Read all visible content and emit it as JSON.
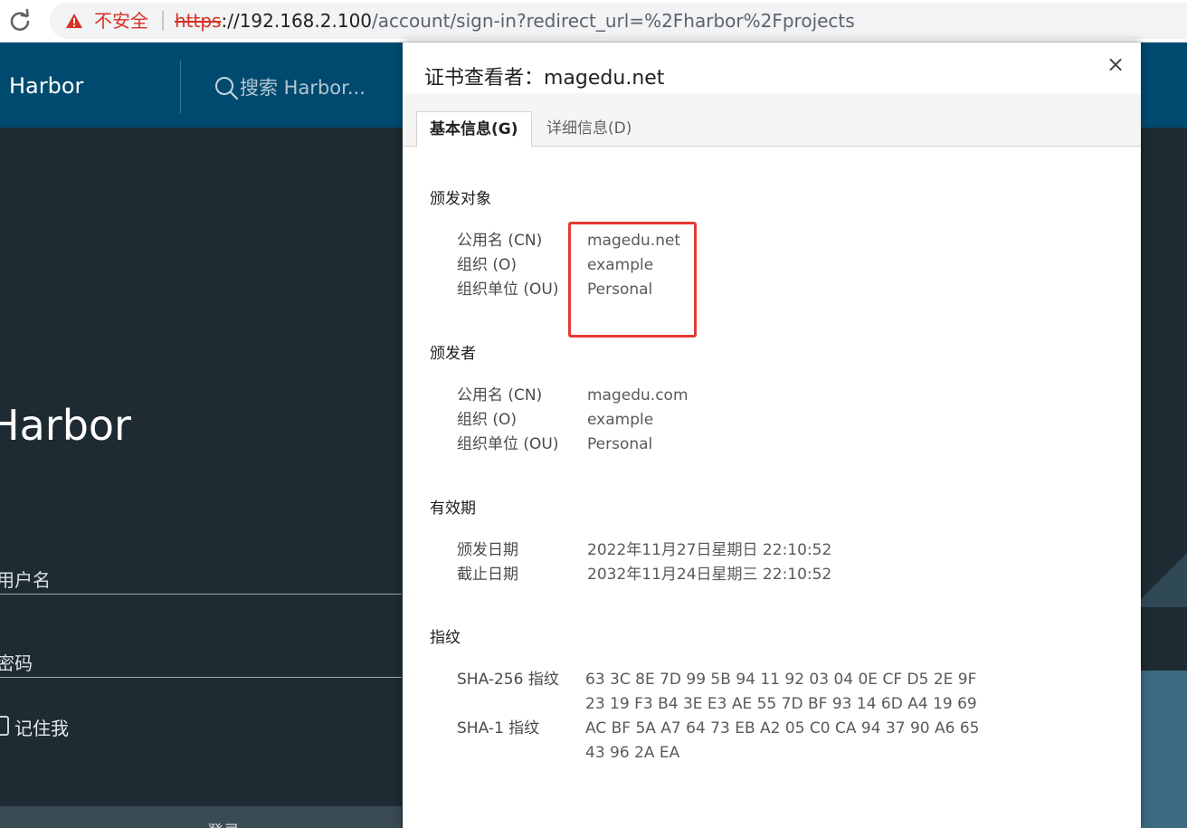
{
  "browser": {
    "security_label": "不安全",
    "url_scheme": "https",
    "url_host": "://192.168.2.100",
    "url_rest": "/account/sign-in?redirect_url=%2Fharbor%2Fprojects",
    "warning_color": "#d93025"
  },
  "harbor": {
    "brand": "Harbor",
    "search_placeholder": "搜索 Harbor...",
    "login_title": "Harbor",
    "username_label": "用户名",
    "password_label": "密码",
    "remember_label": "记住我",
    "login_button": "登录",
    "header_color": "#004a70"
  },
  "dialog": {
    "title": "证书查看者：magedu.net",
    "close_label": "×",
    "tabs": [
      {
        "label": "基本信息(G)",
        "active": true
      },
      {
        "label": "详细信息(D)",
        "active": false
      }
    ],
    "issued_to": {
      "heading": "颁发对象",
      "rows": [
        {
          "label": "公用名 (CN)",
          "value": "magedu.net"
        },
        {
          "label": "组织 (O)",
          "value": "example"
        },
        {
          "label": "组织单位 (OU)",
          "value": "Personal"
        }
      ]
    },
    "issued_by": {
      "heading": "颁发者",
      "rows": [
        {
          "label": "公用名 (CN)",
          "value": "magedu.com"
        },
        {
          "label": "组织 (O)",
          "value": "example"
        },
        {
          "label": "组织单位 (OU)",
          "value": "Personal"
        }
      ]
    },
    "validity": {
      "heading": "有效期",
      "rows": [
        {
          "label": "颁发日期",
          "value": "2022年11月27日星期日 22:10:52"
        },
        {
          "label": "截止日期",
          "value": "2032年11月24日星期三 22:10:52"
        }
      ]
    },
    "fingerprints": {
      "heading": "指纹",
      "sha256_label": "SHA-256 指纹",
      "sha256_line1": "63 3C 8E 7D 99 5B 94 11 92 03 04 0E CF D5 2E 9F",
      "sha256_line2": "23 19 F3 B4 3E E3 AE 55 7D BF 93 14 6D A4 19 69",
      "sha1_label": "SHA-1 指纹",
      "sha1_line1": "AC BF 5A A7 64 73 EB A2 05 C0 CA 94 37 90 A6 65",
      "sha1_line2": "43 96 2A EA"
    },
    "highlight_color": "#e53935"
  }
}
